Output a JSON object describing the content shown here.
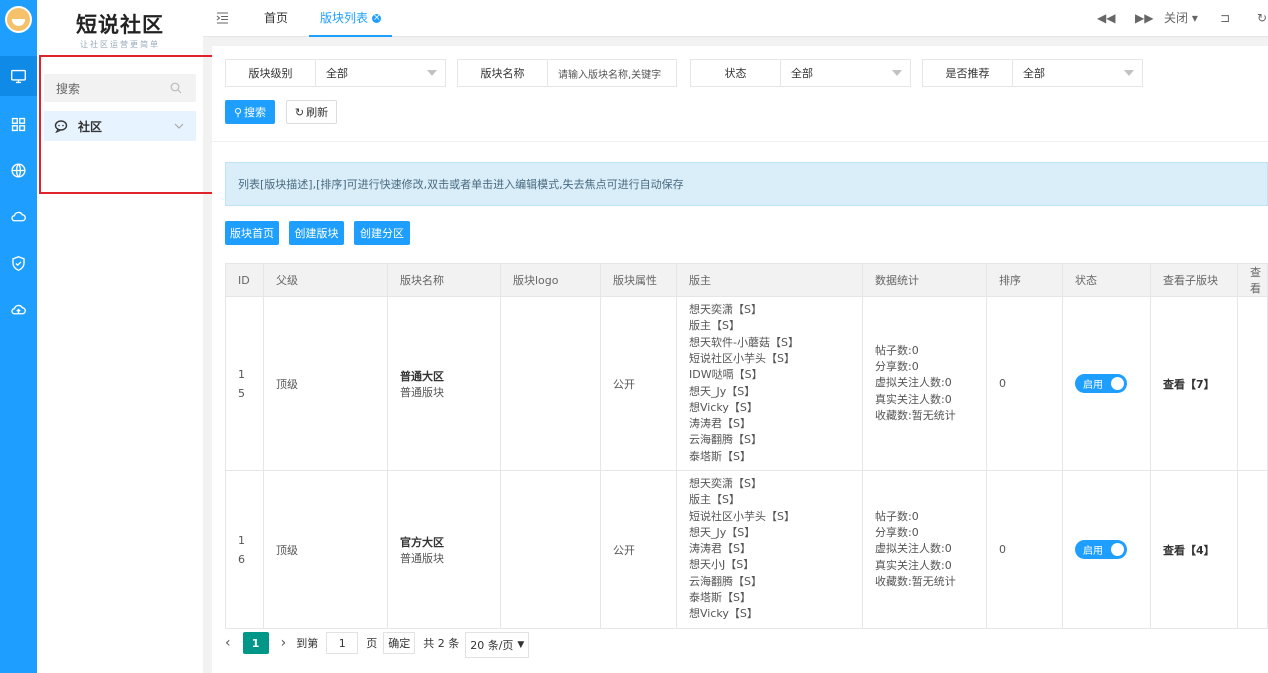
{
  "app": {
    "title": "短说社区",
    "subtitle": "让社区运营更简单"
  },
  "icon_bar": {
    "icons": [
      "avatar",
      "monitor-icon",
      "grid-icon",
      "globe-icon",
      "cloud-icon",
      "shield-icon",
      "cloud-upload-icon"
    ]
  },
  "sidebar": {
    "search_placeholder": "搜索",
    "items": [
      {
        "label": "社区",
        "icon": "chat-icon"
      }
    ]
  },
  "topbar": {
    "tabs": [
      {
        "label": "首页"
      },
      {
        "label": "版块列表"
      }
    ],
    "controls": {
      "close_label": "关闭"
    }
  },
  "filters": [
    {
      "label": "版块级别",
      "value": "全部"
    },
    {
      "label": "版块名称",
      "placeholder": "请输入版块名称,关键字"
    },
    {
      "label": "状态",
      "value": "全部"
    },
    {
      "label": "是否推荐",
      "value": "全部"
    }
  ],
  "buttons": {
    "search": "搜索",
    "refresh": "刷新",
    "board_home": "版块首页",
    "create_board": "创建版块",
    "create_zone": "创建分区"
  },
  "notice": "列表[版块描述],[排序]可进行快速修改,双击或者单击进入编辑模式,失去焦点可进行自动保存",
  "table": {
    "headers": [
      "ID",
      "父级",
      "版块名称",
      "版块logo",
      "版块属性",
      "版主",
      "数据统计",
      "排序",
      "状态",
      "查看子版块",
      "查看"
    ],
    "rows": [
      {
        "id_line1": "1",
        "id_line2": "5",
        "parent": "顶级",
        "name": "普通大区",
        "desc": "普通版块",
        "logo": "",
        "attr": "公开",
        "owners": [
          "想天奕潇【S】",
          "版主【S】",
          "想天软件-小蘑菇【S】",
          "短说社区小芋头【S】",
          "IDW哒嗝【S】",
          "想天_Jy【S】",
          "想Vicky【S】",
          "涛涛君【S】",
          "云海翻腾【S】",
          "泰塔斯【S】"
        ],
        "stats": [
          "帖子数:0",
          "分享数:0",
          "虚拟关注人数:0",
          "真实关注人数:0",
          "收藏数:暂无统计"
        ],
        "sort": "0",
        "status": "启用",
        "sub": "查看【7】"
      },
      {
        "id_line1": "1",
        "id_line2": "6",
        "parent": "顶级",
        "name": "官方大区",
        "desc": "普通版块",
        "logo": "",
        "attr": "公开",
        "owners": [
          "想天奕潇【S】",
          "版主【S】",
          "短说社区小芋头【S】",
          "想天_Jy【S】",
          "涛涛君【S】",
          "想天小J【S】",
          "云海翻腾【S】",
          "泰塔斯【S】",
          "想Vicky【S】"
        ],
        "stats": [
          "帖子数:0",
          "分享数:0",
          "虚拟关注人数:0",
          "真实关注人数:0",
          "收藏数:暂无统计"
        ],
        "sort": "0",
        "status": "启用",
        "sub": "查看【4】"
      }
    ]
  },
  "pager": {
    "current": "1",
    "goto_label": "到第",
    "goto_value": "1",
    "page_label": "页",
    "confirm": "确定",
    "total": "共 2 条",
    "per_page": "20 条/页"
  },
  "colors": {
    "primary": "#1E9FFF",
    "pager_active": "#009688",
    "highlight_box": "#e0222a"
  }
}
